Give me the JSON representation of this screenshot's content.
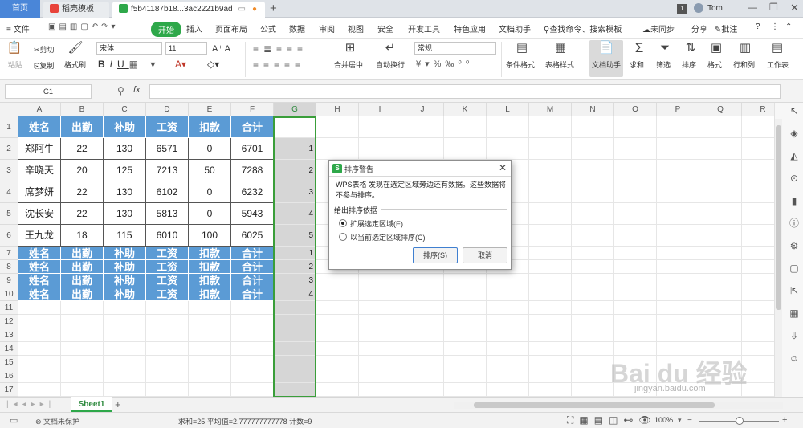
{
  "tabs": {
    "home": "首页",
    "daoke": "稻壳模板",
    "file": "f5b41187b18...3ac2221b9ad",
    "user": "Tom",
    "page_badge": "1"
  },
  "menu": {
    "file": "文件",
    "items": [
      "开始",
      "插入",
      "页面布局",
      "公式",
      "数据",
      "审阅",
      "视图",
      "安全",
      "开发工具",
      "特色应用",
      "文档助手"
    ],
    "search": "查找命令、搜索模板",
    "sync": "未同步",
    "share": "分享",
    "comment": "批注"
  },
  "ribbon": {
    "paste": "粘贴",
    "cut": "剪切",
    "copy": "复制",
    "format_painter": "格式刷",
    "font_name": "宋体",
    "font_size": "11",
    "merge": "合并居中",
    "wrap": "自动换行",
    "number_format": "常规",
    "cond_format": "条件格式",
    "table_style": "表格样式",
    "doc_helper": "文档助手",
    "sum": "求和",
    "filter": "筛选",
    "sort": "排序",
    "format": "格式",
    "rowcol": "行和列",
    "worksheet": "工作表"
  },
  "formula_bar": {
    "name_box": "G1",
    "fx": "fx",
    "content": ""
  },
  "columns": [
    "A",
    "B",
    "C",
    "D",
    "E",
    "F",
    "G",
    "H",
    "I",
    "J",
    "K",
    "L",
    "M",
    "N",
    "O",
    "P",
    "Q",
    "R"
  ],
  "rows": [
    "1",
    "2",
    "3",
    "4",
    "5",
    "6",
    "7",
    "8",
    "9",
    "10",
    "11",
    "12",
    "13",
    "14",
    "15",
    "16",
    "17"
  ],
  "headers": [
    "姓名",
    "出勤",
    "补助",
    "工资",
    "扣款",
    "合计"
  ],
  "records": [
    [
      "郑阿牛",
      "22",
      "130",
      "6571",
      "0",
      "6701"
    ],
    [
      "辛晓天",
      "20",
      "125",
      "7213",
      "50",
      "7288"
    ],
    [
      "席梦妍",
      "22",
      "130",
      "6102",
      "0",
      "6232"
    ],
    [
      "沈长安",
      "22",
      "130",
      "5813",
      "0",
      "5943"
    ],
    [
      "王九龙",
      "18",
      "115",
      "6010",
      "100",
      "6025"
    ]
  ],
  "g_values": [
    "",
    "1",
    "2",
    "3",
    "4",
    "5",
    "1",
    "2",
    "3",
    "4"
  ],
  "sheet": {
    "tab": "Sheet1",
    "add": "+"
  },
  "status": {
    "protect": "文档未保护",
    "stats": "求和=25  平均值=2.777777777778  计数=9",
    "zoom": "100%"
  },
  "dialog": {
    "title": "排序警告",
    "message": "WPS表格 发现在选定区域旁边还有数据。这些数据将不参与排序。",
    "group_label": "给出排序依据",
    "option1": "扩展选定区域(E)",
    "option2": "以当前选定区域排序(C)",
    "sort_button": "排序(S)",
    "cancel_button": "取消"
  },
  "watermark": {
    "brand": "Bai du 经验",
    "url": "jingyan.baidu.com"
  },
  "colors": {
    "header_blue": "#5b9bd5",
    "accent_green": "#2ea84a",
    "selection_green": "#3a9e3a"
  }
}
